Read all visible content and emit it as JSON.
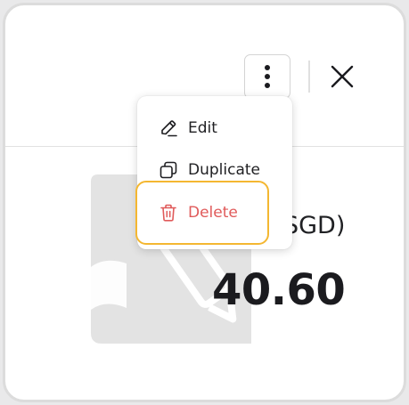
{
  "header": {
    "more_icon": "more-vertical-icon",
    "close_icon": "close-icon"
  },
  "menu": {
    "items": [
      {
        "label": "Edit",
        "icon": "pencil-icon"
      },
      {
        "label": "Duplicate",
        "icon": "copy-icon"
      },
      {
        "label": "Delete",
        "icon": "trash-icon",
        "color": "#e05a5a"
      }
    ],
    "highlight_color": "#f4b731"
  },
  "content": {
    "amount_label": "SGD)",
    "amount_value": "40.60",
    "illustration_icon": "document-edit-icon"
  }
}
